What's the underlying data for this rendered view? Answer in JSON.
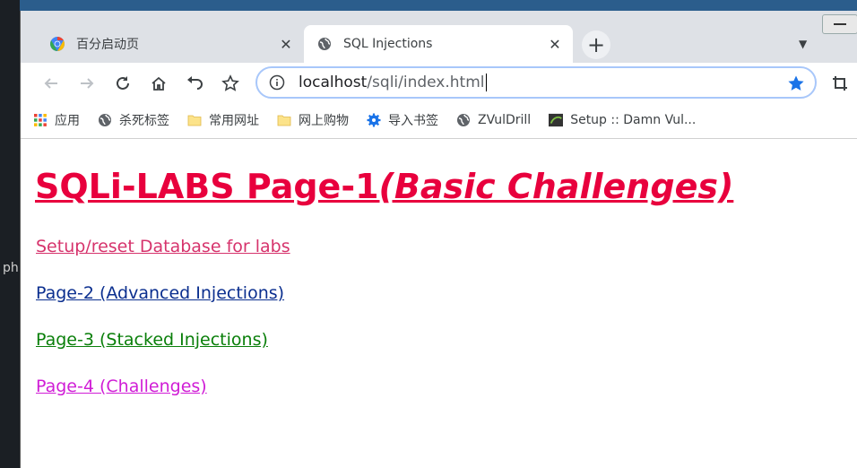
{
  "desktop": {
    "side_text": "ph"
  },
  "tabs": [
    {
      "title": "百分启动页",
      "active": false
    },
    {
      "title": "SQL Injections",
      "active": true
    }
  ],
  "toolbar": {
    "url_host": "localhost",
    "url_path": "/sqli/index.html"
  },
  "bookmarks": [
    {
      "label": "应用",
      "icon": "apps-grid-icon"
    },
    {
      "label": "杀死标签",
      "icon": "globe-icon"
    },
    {
      "label": "常用网址",
      "icon": "folder-icon"
    },
    {
      "label": "网上购物",
      "icon": "folder-icon"
    },
    {
      "label": "导入书签",
      "icon": "gear-icon"
    },
    {
      "label": "ZVulDrill",
      "icon": "globe-icon"
    },
    {
      "label": "Setup :: Damn Vul...",
      "icon": "dvwa-icon"
    }
  ],
  "page": {
    "heading_main": "SQLi-LABS Page-1",
    "heading_sub": "(Basic Challenges)",
    "links": [
      "Setup/reset Database for labs",
      "Page-2 (Advanced Injections)",
      "Page-3 (Stacked Injections)",
      "Page-4 (Challenges)"
    ]
  },
  "colors": {
    "heading": "#e8003d",
    "link_setup": "#d6336c",
    "link_page2": "#0b2f8f",
    "link_page3": "#0a7f0a",
    "link_page4": "#d01dd6",
    "star": "#1a73e8"
  }
}
